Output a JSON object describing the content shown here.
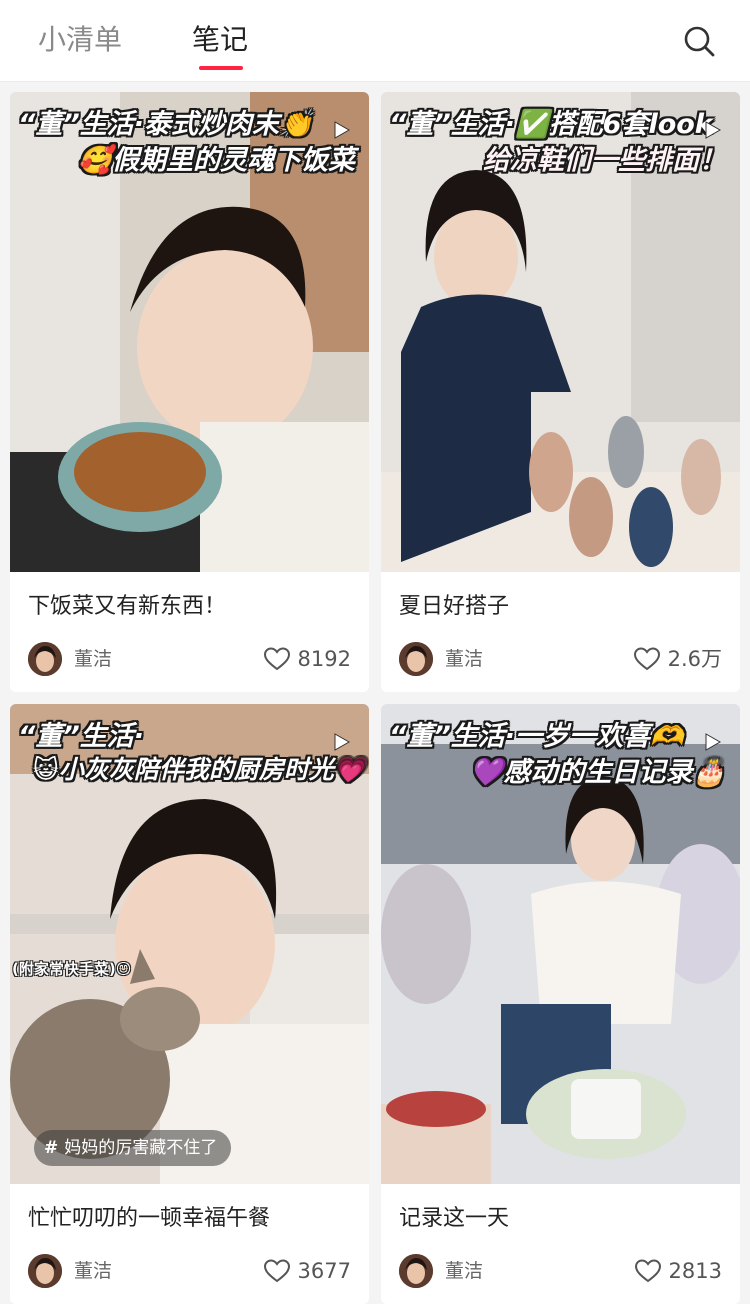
{
  "header": {
    "tabs": [
      {
        "label": "小清单",
        "active": false
      },
      {
        "label": "笔记",
        "active": true
      }
    ],
    "accent_color": "#ff2442",
    "search_icon": "search-icon"
  },
  "notes": [
    {
      "cover_overlay": [
        "“董”生活·泰式炒肉末👏",
        "🥰假期里的灵魂下饭菜"
      ],
      "title": "下饭菜又有新东西！",
      "author": "董洁",
      "likes": "8192",
      "is_video": true
    },
    {
      "cover_overlay": [
        "“董”生活·✅搭配6套look",
        "给凉鞋们一些排面！"
      ],
      "title": "夏日好搭子",
      "author": "董洁",
      "likes": "2.6万",
      "is_video": true
    },
    {
      "cover_overlay": [
        "“董”生活·",
        "😺小灰灰陪伴我的厨房时光💗"
      ],
      "cover_side_tag": "(附家常快手菜)😊",
      "cover_topic": "妈妈的厉害藏不住了",
      "title": "忙忙叨叨的一顿幸福午餐",
      "author": "董洁",
      "likes": "3677",
      "is_video": true
    },
    {
      "cover_overlay": [
        "“董”生活·一岁一欢喜🫶",
        "💜感动的生日记录🎂"
      ],
      "title": "记录这一天",
      "author": "董洁",
      "likes": "2813",
      "is_video": true
    }
  ]
}
